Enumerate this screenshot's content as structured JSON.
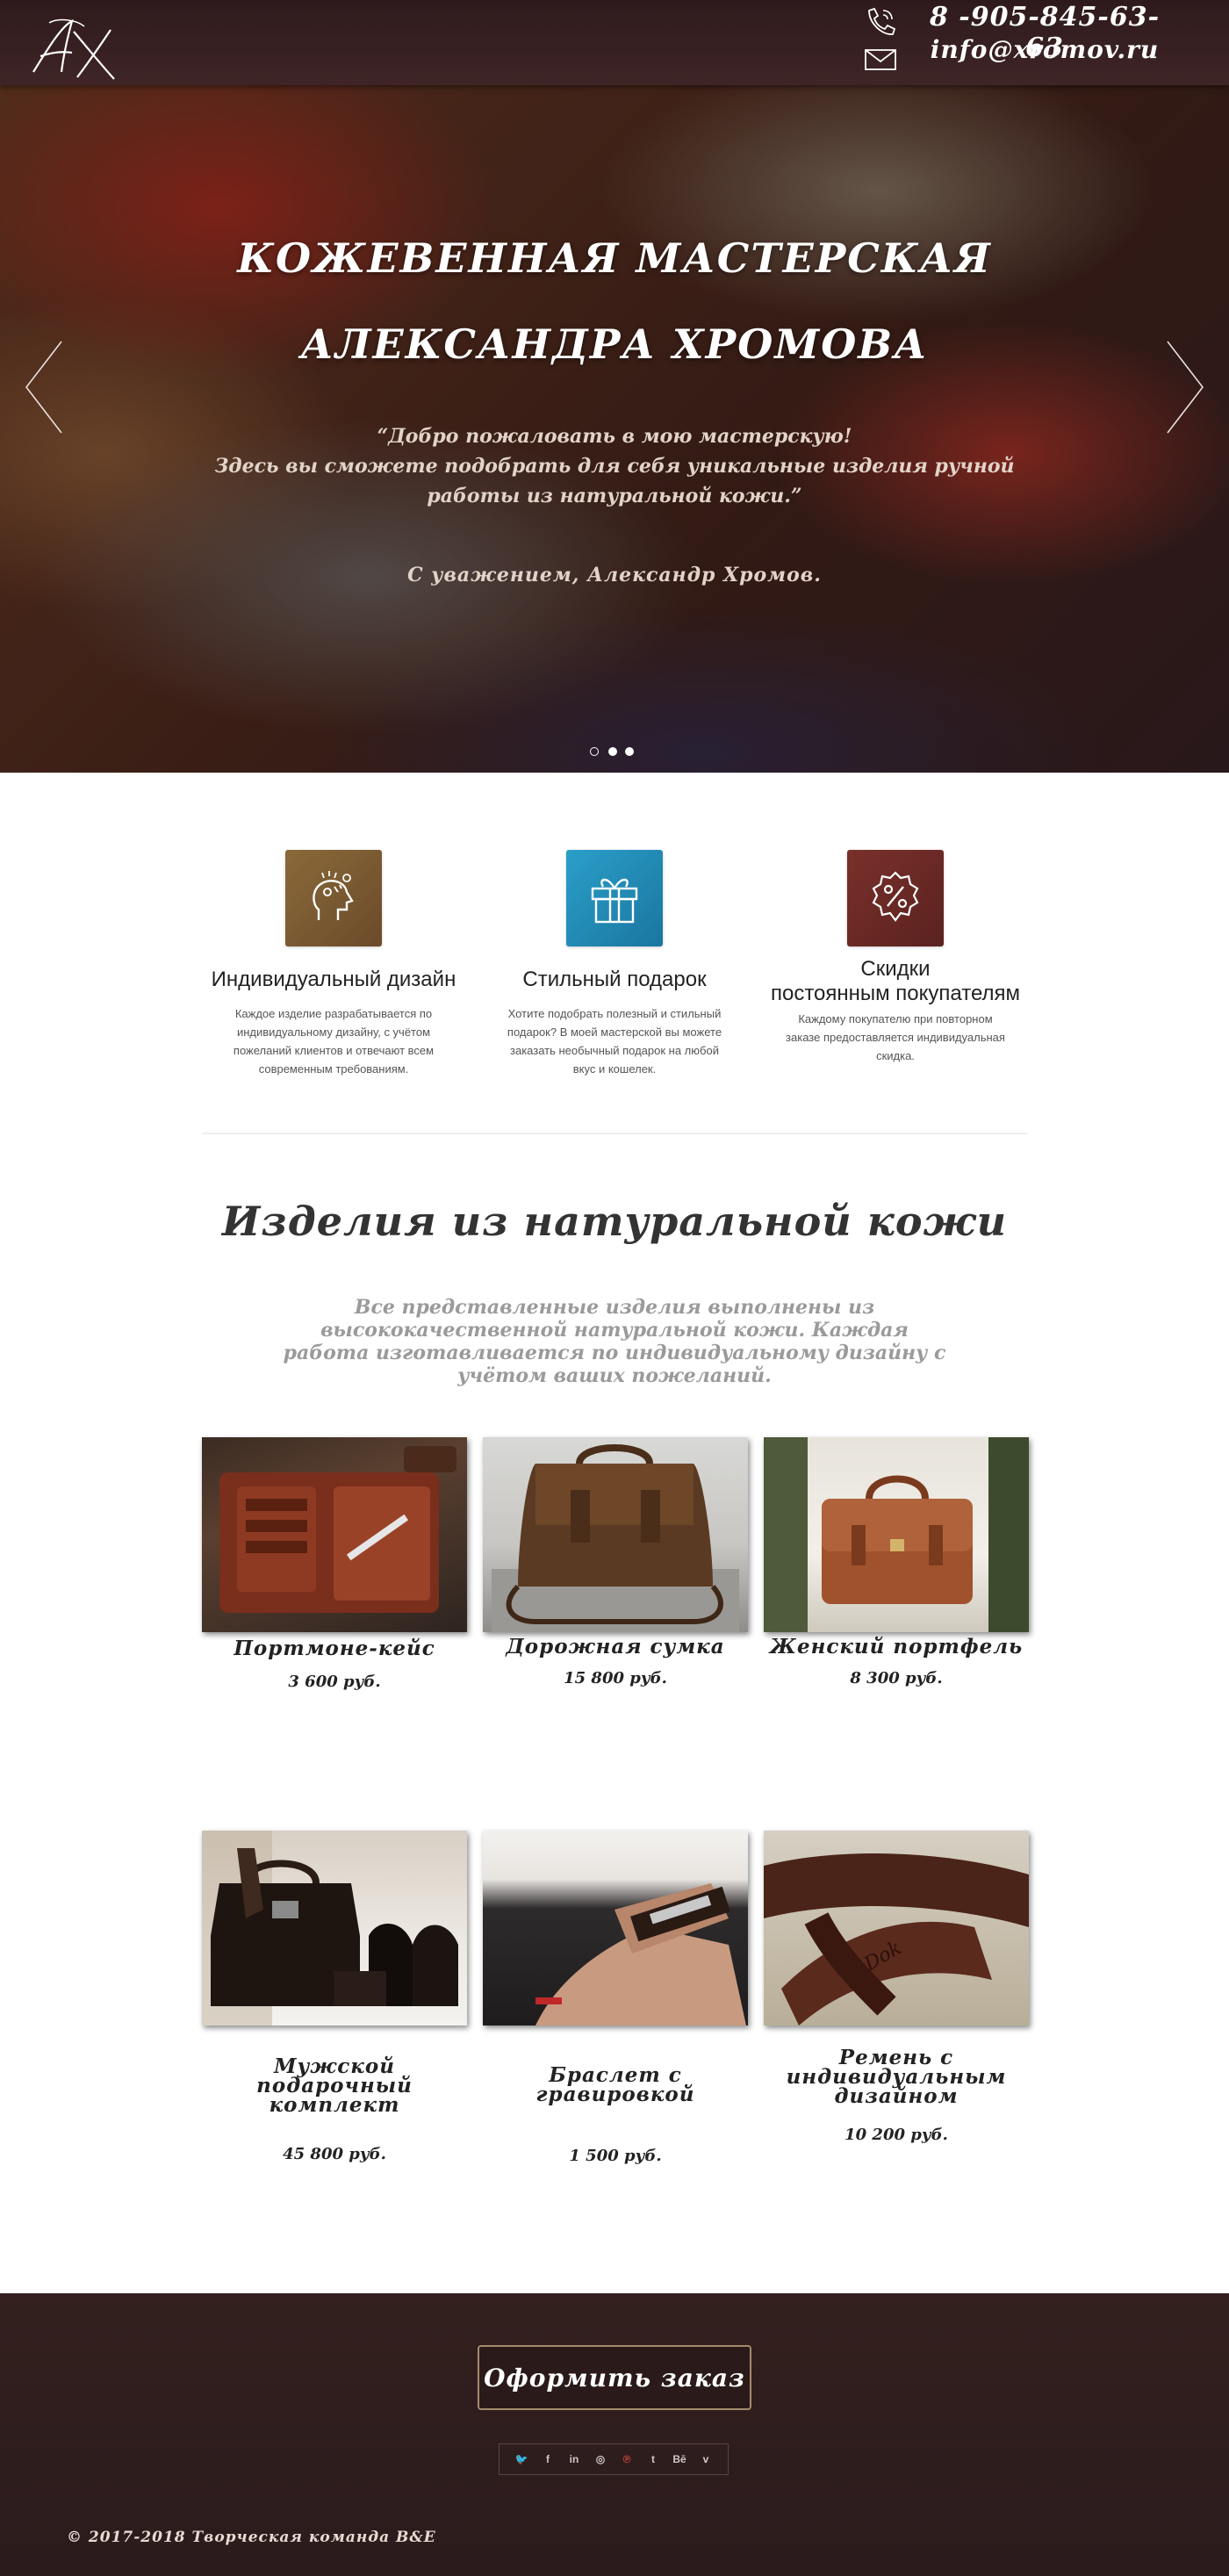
{
  "header": {
    "logo_text": "AX",
    "phone": "8 -905-845-63-63",
    "email": "info@xromov.ru",
    "icons": [
      "phone-icon",
      "mail-icon"
    ]
  },
  "hero": {
    "title_line1": "КОЖЕВЕННАЯ МАСТЕРСКАЯ",
    "title_line2": "АЛЕКСАНДРА ХРОМОВА",
    "quote_line1": "“Добро пожаловать в мою мастерскую!",
    "quote_line2": "Здесь вы сможете подобрать для себя уникальные изделия ручной",
    "quote_line3": "работы из натуральной кожи.”",
    "signature": "С уважением, Александр Хромов.",
    "slides": 3,
    "active_slide": 1
  },
  "features": [
    {
      "title": "Индивидуальный дизайн",
      "text": "Каждое изделие разрабатывается по индивидуальному дизайну, с учётом пожеланий клиентов и отвечают всем современным требованиям.",
      "icon": "head-ideas-icon",
      "color": "#7a5a33"
    },
    {
      "title": "Стильный подарок",
      "text": "Хотите подобрать полезный и стильный подарок? В моей мастерской вы можете заказать необычный подарок на любой вкус и кошелек.",
      "icon": "gift-icon",
      "color": "#1e88b3"
    },
    {
      "title_line1": "Скидки",
      "title_line2": "постоянным покупателям",
      "text": "Каждому покупателю при повторном заказе предоставляется индивидуальная скидка.",
      "icon": "discount-badge-icon",
      "color": "#6b2a26"
    }
  ],
  "products_section": {
    "title": "Изделия из натуральной кожи",
    "text": "Все представленные изделия выполнены из высококачественной натуральной кожи. Каждая работа изготавливается по индивидуальному дизайну с учётом ваших пожеланий."
  },
  "products": [
    {
      "name": "Портмоне-кейс",
      "price": "3 600 руб."
    },
    {
      "name": "Дорожная сумка",
      "price": "15 800 руб."
    },
    {
      "name": "Женский портфель",
      "price": "8 300 руб."
    },
    {
      "name_line1": "Мужской подарочный",
      "name_line2": "комплект",
      "price": "45 800 руб."
    },
    {
      "name": "Браслет с гравировкой",
      "price": "1 500 руб."
    },
    {
      "name_line1": "Ремень с",
      "name_line2": "индивидуальным",
      "name_line3": "дизайном",
      "price": "10 200 руб."
    }
  ],
  "footer": {
    "order_button": "Оформить заказ",
    "social": [
      "twitter-icon",
      "facebook-icon",
      "linkedin-icon",
      "dribbble-icon",
      "pinterest-icon",
      "tumblr-icon",
      "behance-icon",
      "vimeo-icon"
    ],
    "social_glyphs": [
      "🐦",
      "f",
      "in",
      "◎",
      "℗",
      "t",
      "Bē",
      "v"
    ],
    "copyright": "© 2017-2018 Творческая команда B&E"
  },
  "colors": {
    "header_bg": "#3a2324",
    "footer_bg": "#2f1e1e",
    "button_border": "#a48b6b",
    "pinterest": "#d64b3c"
  }
}
